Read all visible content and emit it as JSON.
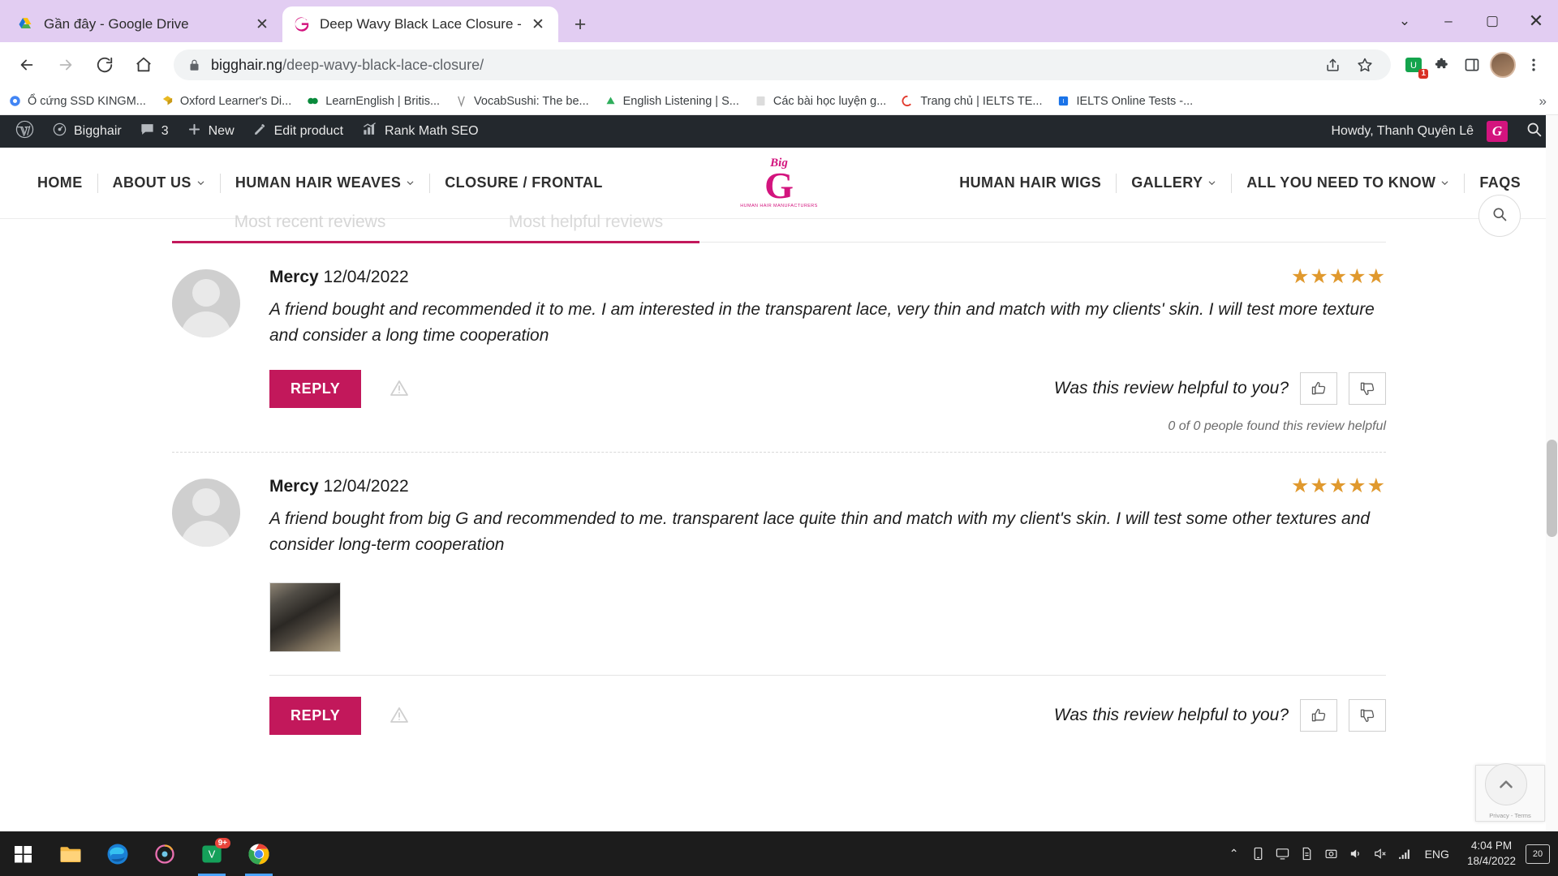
{
  "browser": {
    "tabs": [
      {
        "title": "Gần đây - Google Drive",
        "favicon": "google-drive-icon",
        "active": false
      },
      {
        "title": "Deep Wavy Black Lace Closure -",
        "favicon": "bigg-logo-icon",
        "active": true
      }
    ],
    "newtab_label": "+",
    "window_controls": {
      "minimize": "–",
      "maximize": "▢",
      "close": "✕",
      "dropdown": "⌄"
    },
    "nav": {
      "back": "←",
      "forward": "→",
      "reload": "⟳",
      "home": "⌂"
    },
    "omnibox": {
      "lock_icon": "lock-icon",
      "domain": "bigghair.ng",
      "path": "/deep-wavy-black-lace-closure/",
      "full_url": "bigghair.ng/deep-wavy-black-lace-closure/",
      "share_icon": "share-icon",
      "bookmark_icon": "star-icon"
    },
    "toolbar_right": {
      "extension_badge_count": "1",
      "extensions_icon": "puzzle-icon",
      "sidepanel_icon": "side-panel-icon",
      "profile_icon": "avatar-icon",
      "menu_icon": "kebab-menu-icon"
    },
    "bookmarks": [
      {
        "label": "Ổ cứng SSD KINGM...",
        "color": "#4285f4"
      },
      {
        "label": "Oxford Learner's Di...",
        "color": "#e8b923"
      },
      {
        "label": "LearnEnglish | Britis...",
        "color": "#0a8a3c"
      },
      {
        "label": "VocabSushi: The be...",
        "color": "#888888"
      },
      {
        "label": "English Listening | S...",
        "color": "#2fae5c"
      },
      {
        "label": "Các bài học luyện g...",
        "color": "#bbbbbb"
      },
      {
        "label": "Trang chủ | IELTS TE...",
        "color": "#e23b2e"
      },
      {
        "label": "IELTS Online Tests -...",
        "color": "#1a73e8"
      }
    ],
    "bookmarks_overflow": "»"
  },
  "wp_adminbar": {
    "logo": "wordpress-icon",
    "site_name": "Bigghair",
    "comments_count": "3",
    "new_label": "New",
    "edit_label": "Edit product",
    "seo_label": "Rank Math SEO",
    "howdy": "Howdy, Thanh Quyên Lê",
    "avatar_letter": "G",
    "search_icon": "search-icon"
  },
  "site_nav": {
    "left": [
      {
        "label": "HOME",
        "caret": false
      },
      {
        "label": "ABOUT US",
        "caret": true
      },
      {
        "label": "HUMAN HAIR WEAVES",
        "caret": true
      },
      {
        "label": "CLOSURE / FRONTAL",
        "caret": false
      }
    ],
    "right": [
      {
        "label": "HUMAN HAIR WIGS",
        "caret": false
      },
      {
        "label": "GALLERY",
        "caret": true
      },
      {
        "label": "ALL YOU NEED TO KNOW",
        "caret": true
      },
      {
        "label": "FAQS",
        "caret": false
      }
    ],
    "logo": {
      "big": "Big",
      "letter": "G",
      "sub": "HUMAN HAIR MANUFACTURERS"
    },
    "search_icon": "search-icon"
  },
  "reviews_section": {
    "tabs": [
      {
        "label": "Most recent reviews",
        "active": true
      },
      {
        "label": "Most helpful reviews",
        "active": false
      }
    ],
    "items": [
      {
        "author": "Mercy",
        "date": "12/04/2022",
        "text": "A friend bought and recommended it to me. I am interested in the transparent lace, very thin and match with my clients' skin. I will test more texture and consider a long time cooperation",
        "stars": "★★★★★",
        "reply_label": "REPLY",
        "flag_icon": "flag-report-icon",
        "helpful_question": "Was this review helpful to you?",
        "thumb_up_icon": "thumbs-up-icon",
        "thumb_down_icon": "thumbs-down-icon",
        "helpful_count": "0 of 0 people found this review helpful",
        "has_photo": false
      },
      {
        "author": "Mercy",
        "date": "12/04/2022",
        "text": "A friend bought from big G and recommended to me. transparent lace quite thin and match with my client's skin. I will test some other textures and consider long-term cooperation",
        "stars": "★★★★★",
        "reply_label": "REPLY",
        "flag_icon": "flag-report-icon",
        "helpful_question": "Was this review helpful to you?",
        "thumb_up_icon": "thumbs-up-icon",
        "thumb_down_icon": "thumbs-down-icon",
        "helpful_count": "",
        "has_photo": true
      }
    ]
  },
  "widgets": {
    "recaptcha_line1": "Privacy",
    "recaptcha_line2": "Terms",
    "back_to_top_icon": "chevron-up-icon"
  },
  "taskbar": {
    "start_icon": "windows-start-icon",
    "apps": [
      {
        "name": "file-explorer-icon",
        "badge": ""
      },
      {
        "name": "microsoft-edge-icon",
        "badge": ""
      },
      {
        "name": "media-player-icon",
        "badge": ""
      },
      {
        "name": "unikey-icon",
        "badge": "9+"
      },
      {
        "name": "google-chrome-icon",
        "badge": ""
      }
    ],
    "tray": {
      "chevron": "⌃",
      "icons": [
        "device-icon",
        "display-icon",
        "document-icon",
        "capture-icon",
        "volume-icon",
        "mute-icon",
        "network-icon"
      ],
      "language": "ENG",
      "time": "4:04 PM",
      "date": "18/4/2022",
      "notification_count": "20"
    }
  },
  "colors": {
    "brand_pink": "#c2185b",
    "logo_pink": "#d3147e",
    "star_gold": "#e0992e",
    "tab_purple": "#e2cdf2",
    "wp_dark": "#23282d"
  }
}
